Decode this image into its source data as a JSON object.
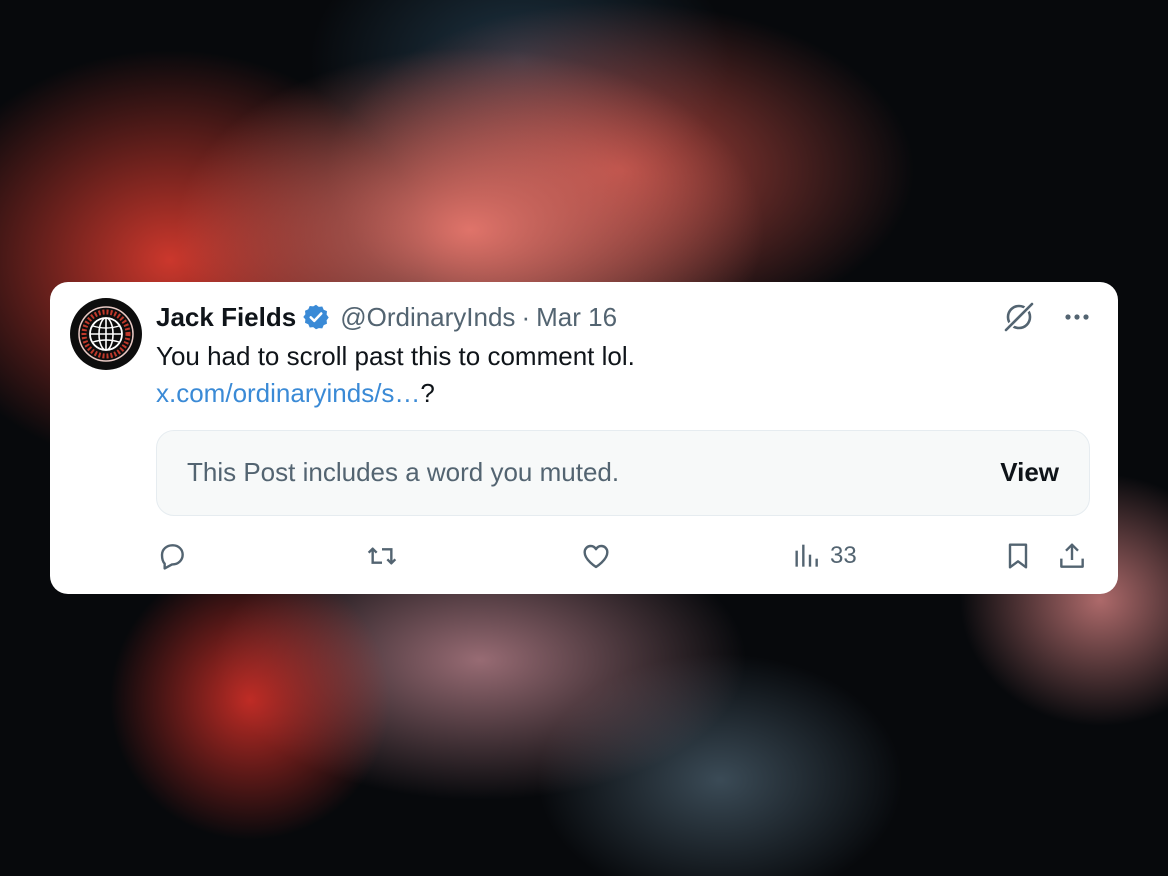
{
  "post": {
    "author_name": "Jack Fields",
    "handle": "@OrdinaryInds",
    "separator": "·",
    "date": "Mar 16",
    "text_line1": "You had to scroll past this to comment lol.",
    "link_text": "x.com/ordinaryinds/s…",
    "link_suffix": "?",
    "muted_notice": "This Post includes a word you muted.",
    "view_label": "View",
    "views_count": "33"
  },
  "icons": {
    "avatar": "globe-logo-avatar",
    "verified": "verified-badge-icon",
    "grok": "grok-icon",
    "more": "more-icon",
    "reply": "reply-icon",
    "repost": "repost-icon",
    "like": "like-icon",
    "views": "views-icon",
    "bookmark": "bookmark-icon",
    "share": "share-icon"
  },
  "colors": {
    "link": "#3a8ad6",
    "verified": "#3a8ad6",
    "secondary_text": "#536471",
    "primary_text": "#0f1419"
  }
}
